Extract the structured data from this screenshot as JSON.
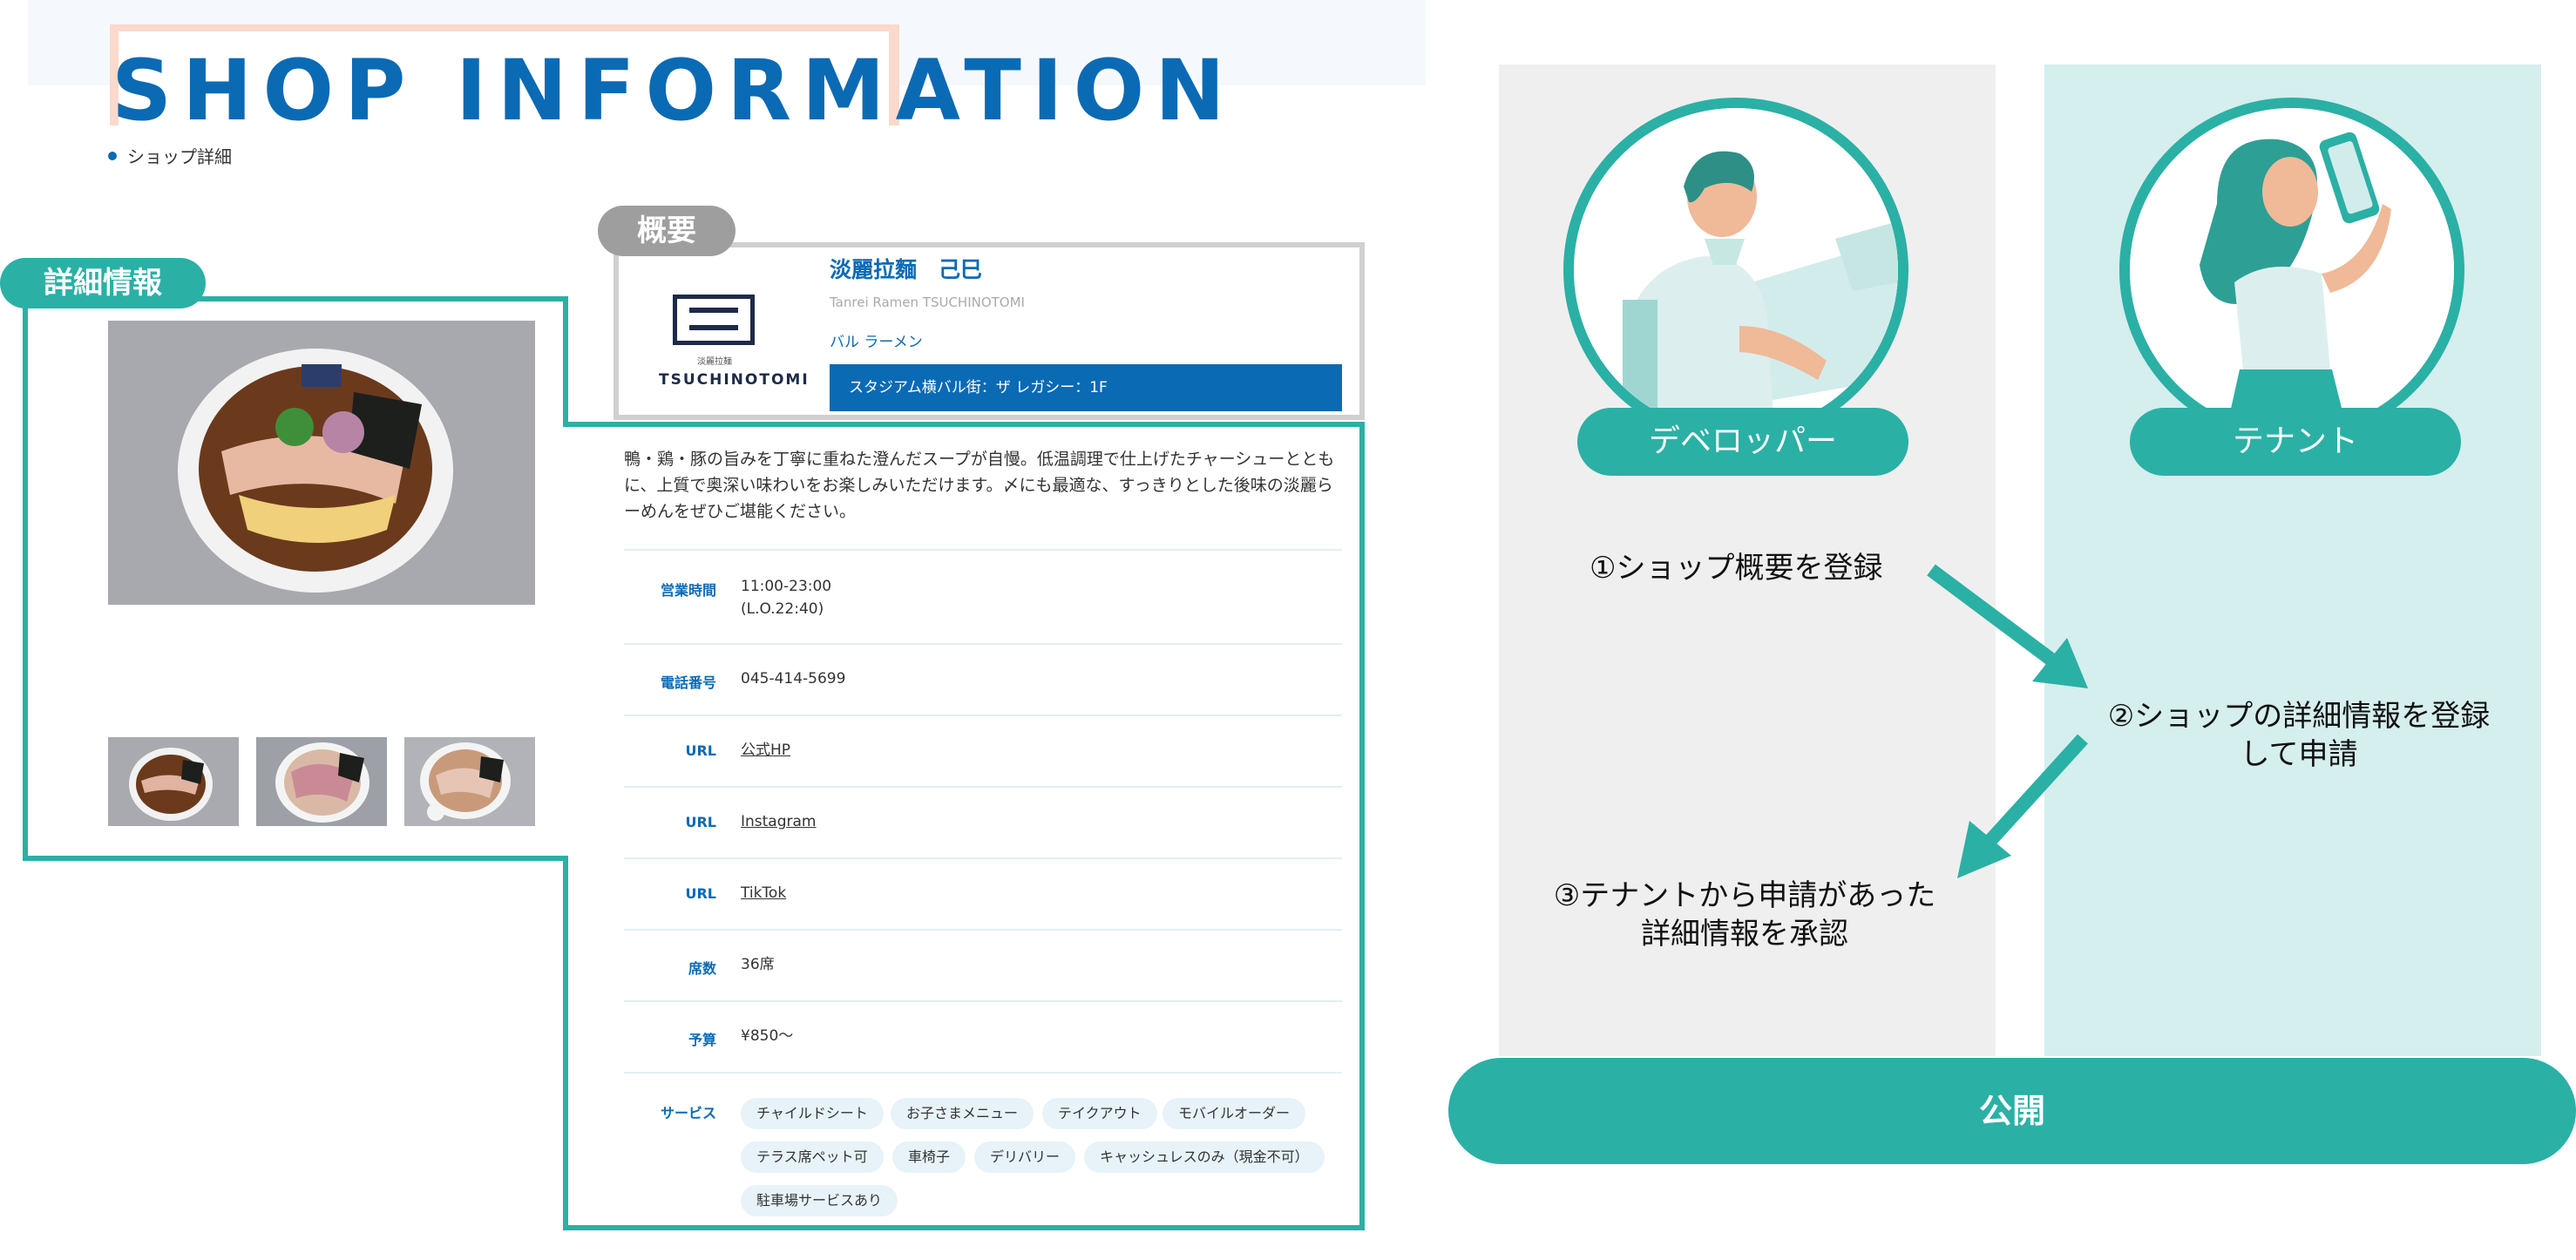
{
  "header": {
    "page_title": "SHOP INFORMATION",
    "breadcrumb": "ショップ詳細"
  },
  "labels": {
    "detail": "詳細情報",
    "overview": "概要"
  },
  "shop": {
    "logo_sub": "淡麗拉麺",
    "logo_text": "TSUCHINOTOMI",
    "name": "淡麗拉麵　己巳",
    "name_en": "Tanrei Ramen TSUCHINOTOMI",
    "category": "バル ラーメン",
    "location": "スタジアム横バル街：ザ レガシー：1F",
    "description": "鴨・鶏・豚の旨みを丁寧に重ねた澄んだスープが自慢。低温調理で仕上げたチャーシューとともに、上質で奥深い味わいをお楽しみいただけます。〆にも最適な、すっきりとした後味の淡麗らーめんをぜひご堪能ください。"
  },
  "info_rows": [
    {
      "label": "営業時間",
      "value": "11:00-23:00",
      "value2": "(L.O.22:40)"
    },
    {
      "label": "電話番号",
      "value": "045-414-5699"
    },
    {
      "label": "URL",
      "value": "公式HP"
    },
    {
      "label": "URL",
      "value": "Instagram"
    },
    {
      "label": "URL",
      "value": "TikTok"
    },
    {
      "label": "席数",
      "value": "36席"
    },
    {
      "label": "予算",
      "value": "¥850〜"
    },
    {
      "label": "サービス"
    }
  ],
  "services": [
    "チャイルドシート",
    "お子さまメニュー",
    "テイクアウト",
    "モバイルオーダー",
    "テラス席ペット可",
    "車椅子",
    "デリバリー",
    "キャッシュレスのみ（現金不可）",
    "駐車場サービスあり"
  ],
  "workflow": {
    "developer": "デベロッパー",
    "tenant": "テナント",
    "step1": "①ショップ概要を登録",
    "step2_line1": "②ショップの詳細情報を登録",
    "step2_line2": "して申請",
    "step3_line1": "③テナントから申請があった",
    "step3_line2": "詳細情報を承認",
    "publish": "公開"
  },
  "colors": {
    "teal": "#2bb0a5",
    "brand_blue": "#0b6ab4",
    "overview_gray": "#9e9e9e",
    "tenant_bg": "#d5eeee",
    "developer_bg": "#efefef"
  }
}
